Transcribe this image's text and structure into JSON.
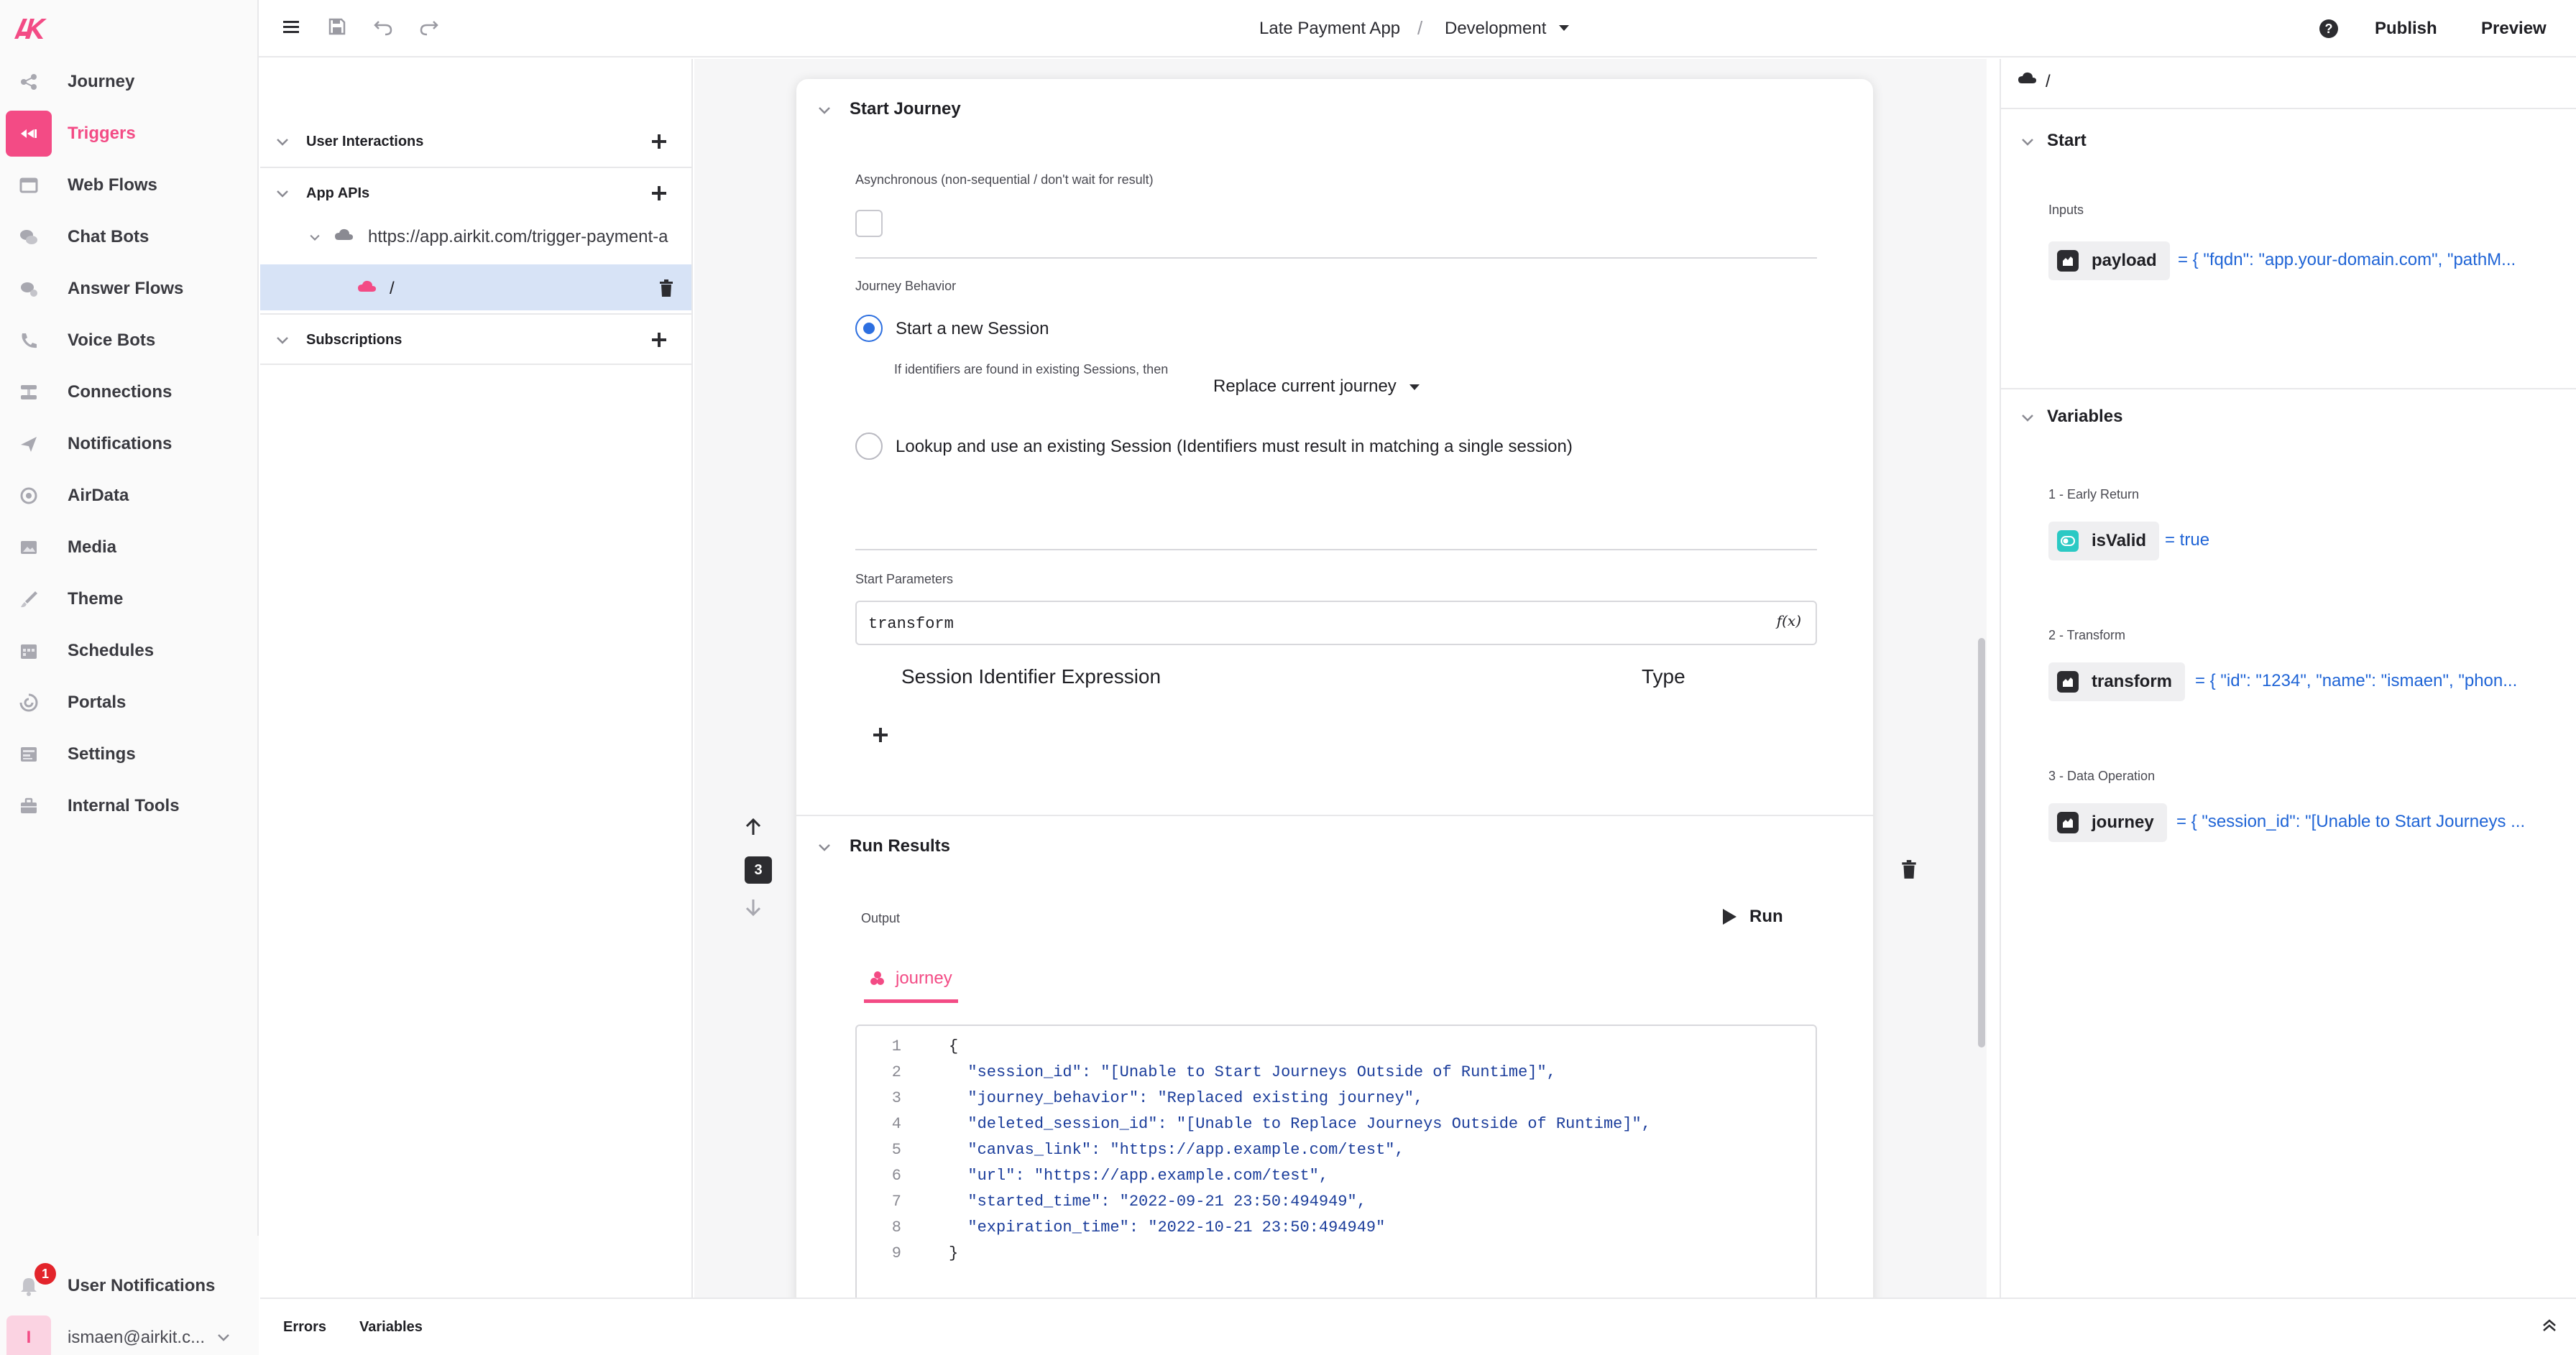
{
  "app": {
    "name": "Late Payment App",
    "environment": "Development",
    "actions": {
      "publish": "Publish",
      "preview": "Preview"
    }
  },
  "nav": {
    "items": [
      {
        "label": "Journey",
        "icon": "journey-icon"
      },
      {
        "label": "Triggers",
        "icon": "triggers-icon",
        "active": true
      },
      {
        "label": "Web Flows",
        "icon": "web-flows-icon"
      },
      {
        "label": "Chat Bots",
        "icon": "chat-bots-icon"
      },
      {
        "label": "Answer Flows",
        "icon": "answer-flows-icon"
      },
      {
        "label": "Voice Bots",
        "icon": "voice-bots-icon"
      },
      {
        "label": "Connections",
        "icon": "connections-icon"
      },
      {
        "label": "Notifications",
        "icon": "notifications-icon"
      },
      {
        "label": "AirData",
        "icon": "airdata-icon"
      },
      {
        "label": "Media",
        "icon": "media-icon"
      },
      {
        "label": "Theme",
        "icon": "theme-icon"
      },
      {
        "label": "Schedules",
        "icon": "schedules-icon"
      },
      {
        "label": "Portals",
        "icon": "portals-icon"
      },
      {
        "label": "Settings",
        "icon": "settings-icon"
      },
      {
        "label": "Internal Tools",
        "icon": "internal-tools-icon"
      }
    ],
    "user_notifications": {
      "label": "User Notifications",
      "badge": "1"
    },
    "user": {
      "initial": "I",
      "email": "ismaen@airkit.c..."
    }
  },
  "tree": {
    "user_interactions": "User Interactions",
    "app_apis": "App APIs",
    "api_url": "https://app.airkit.com/trigger-payment-a",
    "route": "/",
    "subscriptions": "Subscriptions"
  },
  "card": {
    "start_journey": {
      "title": "Start Journey",
      "async_label": "Asynchronous (non-sequential / don't wait for result)",
      "behavior_label": "Journey Behavior",
      "option_new": "Start a new Session",
      "identifiers_hint": "If identifiers are found in existing Sessions, then",
      "replace_select": "Replace current journey",
      "option_lookup": "Lookup and use an existing Session (Identifiers must result in matching a single session)",
      "params_label": "Start Parameters",
      "params_value": "transform",
      "fx": "f(x)",
      "col_expression": "Session Identifier Expression",
      "col_type": "Type"
    },
    "step_number": "3",
    "run_results": {
      "title": "Run Results",
      "output_label": "Output",
      "run_button": "Run",
      "tab": "journey",
      "code": [
        {
          "n": "1",
          "text": "{"
        },
        {
          "n": "2",
          "text": "  \"session_id\": \"[Unable to Start Journeys Outside of Runtime]\","
        },
        {
          "n": "3",
          "text": "  \"journey_behavior\": \"Replaced existing journey\","
        },
        {
          "n": "4",
          "text": "  \"deleted_session_id\": \"[Unable to Replace Journeys Outside of Runtime]\","
        },
        {
          "n": "5",
          "text": "  \"canvas_link\": \"https://app.example.com/test\","
        },
        {
          "n": "6",
          "text": "  \"url\": \"https://app.example.com/test\","
        },
        {
          "n": "7",
          "text": "  \"started_time\": \"2022-09-21 23:50:494949\","
        },
        {
          "n": "8",
          "text": "  \"expiration_time\": \"2022-10-21 23:50:494949\""
        },
        {
          "n": "9",
          "text": "}"
        }
      ]
    }
  },
  "right": {
    "path": "/",
    "start": {
      "title": "Start",
      "inputs_label": "Inputs",
      "payload": {
        "name": "payload",
        "value": "= { \"fqdn\": \"app.your-domain.com\", \"pathM..."
      }
    },
    "variables": {
      "title": "Variables",
      "groups": [
        {
          "label": "1 - Early Return",
          "name": "isValid",
          "value": "= true"
        },
        {
          "label": "2 - Transform",
          "name": "transform",
          "value": "= { \"id\": \"1234\", \"name\": \"ismaen\", \"phon..."
        },
        {
          "label": "3 - Data Operation",
          "name": "journey",
          "value": "= { \"session_id\": \"[Unable to Start Journeys ..."
        }
      ]
    }
  },
  "bottom": {
    "errors": "Errors",
    "variables": "Variables"
  },
  "colors": {
    "accent": "#f34b85",
    "link": "#1f64d6",
    "selected_row": "#d7e3f6",
    "radio": "#2d6fe0"
  }
}
